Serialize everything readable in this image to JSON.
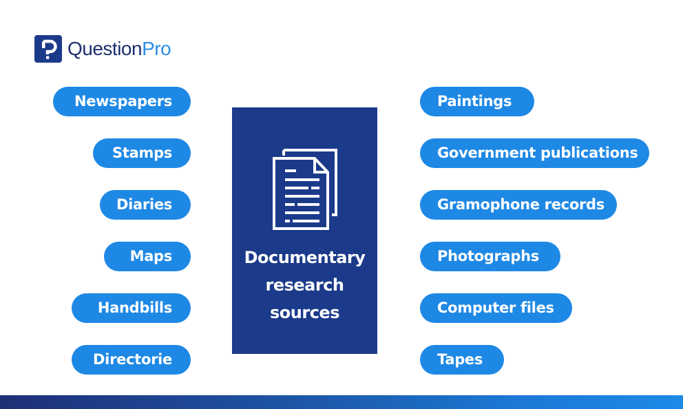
{
  "brand": {
    "name_part1": "Question",
    "name_part2": "Pro",
    "logo_icon": "questionpro-logo-icon",
    "colors": {
      "navy": "#1b3a8a",
      "text_navy": "#1b2f6e",
      "accent_blue": "#2a8ee6"
    }
  },
  "diagram": {
    "center": {
      "icon": "document-icon",
      "title_lines": [
        "Documentary",
        "research",
        "sources"
      ],
      "background": "#1b3a8a"
    },
    "left_items": [
      {
        "label": "Newspapers"
      },
      {
        "label": "Stamps"
      },
      {
        "label": "Diaries"
      },
      {
        "label": "Maps"
      },
      {
        "label": "Handbills"
      },
      {
        "label": "Directorie"
      }
    ],
    "right_items": [
      {
        "label": "Paintings"
      },
      {
        "label": "Government publications"
      },
      {
        "label": "Gramophone records"
      },
      {
        "label": "Photographs"
      },
      {
        "label": "Computer files"
      },
      {
        "label": "Tapes"
      }
    ],
    "pill_color": "#1e88e5"
  },
  "footer": {
    "gradient_start": "#1f2f77",
    "gradient_end": "#1d8ae8"
  }
}
